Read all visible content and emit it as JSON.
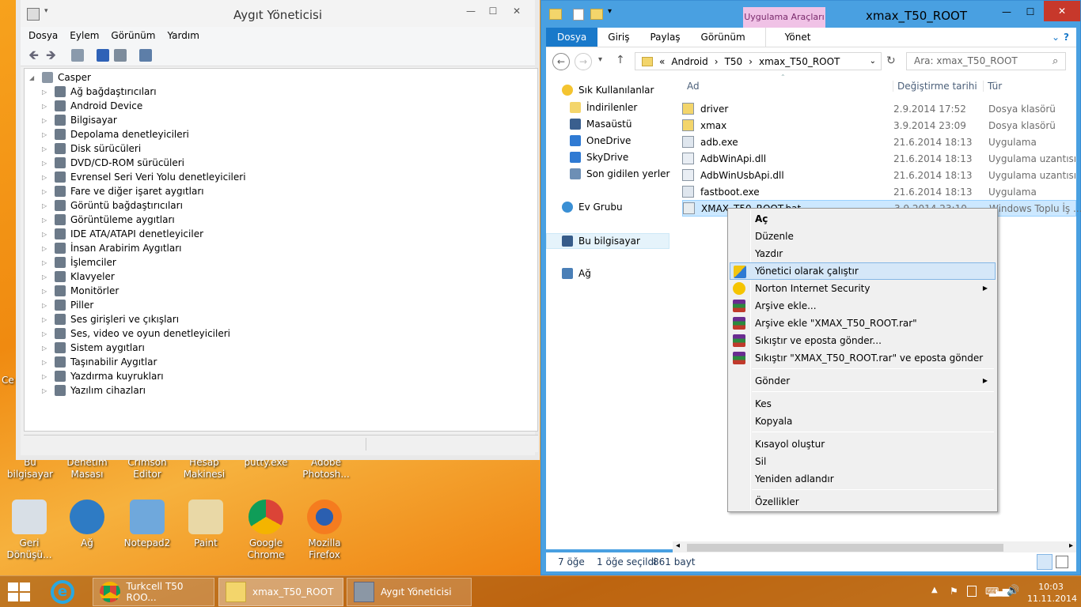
{
  "colors": {
    "accent": "#1979ca",
    "explorer_frame": "#49a0e1",
    "menu_highlight": "#d5e7f8",
    "tools_tab": "#f0c2e6"
  },
  "desktop": {
    "icons_row1": [
      {
        "label": "Bu bilgisayar"
      },
      {
        "label": "Denetim Masası"
      },
      {
        "label": "Crimson Editor"
      },
      {
        "label": "Hesap Makinesi"
      },
      {
        "label": "putty.exe"
      },
      {
        "label": "Adobe Photosh..."
      }
    ],
    "icons_row2": [
      {
        "label": "Geri Dönüşü...",
        "icon": "recycle-bin-icon"
      },
      {
        "label": "Ağ",
        "icon": "network-globe-icon"
      },
      {
        "label": "Notepad2",
        "icon": "notepad-icon"
      },
      {
        "label": "Paint",
        "icon": "paint-palette-icon"
      },
      {
        "label": "Google Chrome",
        "icon": "chrome-icon"
      },
      {
        "label": "Mozilla Firefox",
        "icon": "firefox-icon"
      }
    ],
    "left_edge_text": "Ce"
  },
  "taskbar": {
    "buttons": [
      {
        "label": "Turkcell T50 ROO..."
      },
      {
        "label": "xmax_T50_ROOT"
      },
      {
        "label": "Aygıt Yöneticisi"
      }
    ],
    "time": "10:03",
    "date": "11.11.2014"
  },
  "devmgr": {
    "title": "Aygıt Yöneticisi",
    "menu": [
      "Dosya",
      "Eylem",
      "Görünüm",
      "Yardım"
    ],
    "root": "Casper",
    "nodes": [
      "Ağ bağdaştırıcıları",
      "Android Device",
      "Bilgisayar",
      "Depolama denetleyicileri",
      "Disk sürücüleri",
      "DVD/CD-ROM sürücüleri",
      "Evrensel Seri Veri Yolu denetleyicileri",
      "Fare ve diğer işaret aygıtları",
      "Görüntü bağdaştırıcıları",
      "Görüntüleme aygıtları",
      "IDE ATA/ATAPI denetleyiciler",
      "İnsan Arabirim Aygıtları",
      "İşlemciler",
      "Klavyeler",
      "Monitörler",
      "Piller",
      "Ses girişleri ve çıkışları",
      "Ses, video ve oyun denetleyicileri",
      "Sistem aygıtları",
      "Taşınabilir Aygıtlar",
      "Yazdırma kuyrukları",
      "Yazılım cihazları"
    ]
  },
  "explorer": {
    "title": "xmax_T50_ROOT",
    "tools_tab": "Uygulama Araçları",
    "tabs": [
      "Dosya",
      "Giriş",
      "Paylaş",
      "Görünüm",
      "Yönet"
    ],
    "breadcrumb": [
      "«",
      "Android",
      "›",
      "T50",
      "›",
      "xmax_T50_ROOT"
    ],
    "search_placeholder": "Ara: xmax_T50_ROOT",
    "nav": {
      "favorites": "Sık Kullanılanlar",
      "fav_items": [
        "İndirilenler",
        "Masaüstü",
        "OneDrive",
        "SkyDrive",
        "Son gidilen yerler"
      ],
      "homegroup": "Ev Grubu",
      "thispc": "Bu bilgisayar",
      "network": "Ağ"
    },
    "columns": {
      "name": "Ad",
      "date": "Değiştirme tarihi",
      "type": "Tür"
    },
    "files": [
      {
        "name": "driver",
        "date": "2.9.2014 17:52",
        "type": "Dosya klasörü",
        "kind": "folder"
      },
      {
        "name": "xmax",
        "date": "3.9.2014 23:09",
        "type": "Dosya klasörü",
        "kind": "folder"
      },
      {
        "name": "adb.exe",
        "date": "21.6.2014 18:13",
        "type": "Uygulama",
        "kind": "exe"
      },
      {
        "name": "AdbWinApi.dll",
        "date": "21.6.2014 18:13",
        "type": "Uygulama uzantısı",
        "kind": "dll"
      },
      {
        "name": "AdbWinUsbApi.dll",
        "date": "21.6.2014 18:13",
        "type": "Uygulama uzantısı",
        "kind": "dll"
      },
      {
        "name": "fastboot.exe",
        "date": "21.6.2014 18:13",
        "type": "Uygulama",
        "kind": "exe"
      },
      {
        "name": "XMAX_T50_ROOT.bat",
        "date": "3.9.2014 23:10",
        "type": "Windows Toplu İş ...",
        "kind": "bat"
      }
    ],
    "status": {
      "count": "7 öğe",
      "selected": "1 öğe seçildi",
      "size": "861 bayt"
    }
  },
  "context_menu": {
    "items": [
      {
        "label": "Aç",
        "bold": true
      },
      {
        "label": "Düzenle"
      },
      {
        "label": "Yazdır"
      },
      {
        "label": "Yönetici olarak çalıştır",
        "icon": "uac-shield-icon",
        "highlight": true
      },
      {
        "label": "Norton Internet Security",
        "icon": "norton-icon",
        "submenu": true
      },
      {
        "label": "Arşive ekle...",
        "icon": "winrar-icon"
      },
      {
        "label": "Arşive ekle \"XMAX_T50_ROOT.rar\"",
        "icon": "winrar-icon"
      },
      {
        "label": "Sıkıştır ve eposta gönder...",
        "icon": "winrar-icon"
      },
      {
        "label": "Sıkıştır \"XMAX_T50_ROOT.rar\" ve eposta gönder",
        "icon": "winrar-icon"
      },
      {
        "label": "Gönder",
        "submenu": true
      },
      {
        "label": "Kes"
      },
      {
        "label": "Kopyala"
      },
      {
        "label": "Kısayol oluştur"
      },
      {
        "label": "Sil"
      },
      {
        "label": "Yeniden adlandır"
      },
      {
        "label": "Özellikler"
      }
    ]
  }
}
